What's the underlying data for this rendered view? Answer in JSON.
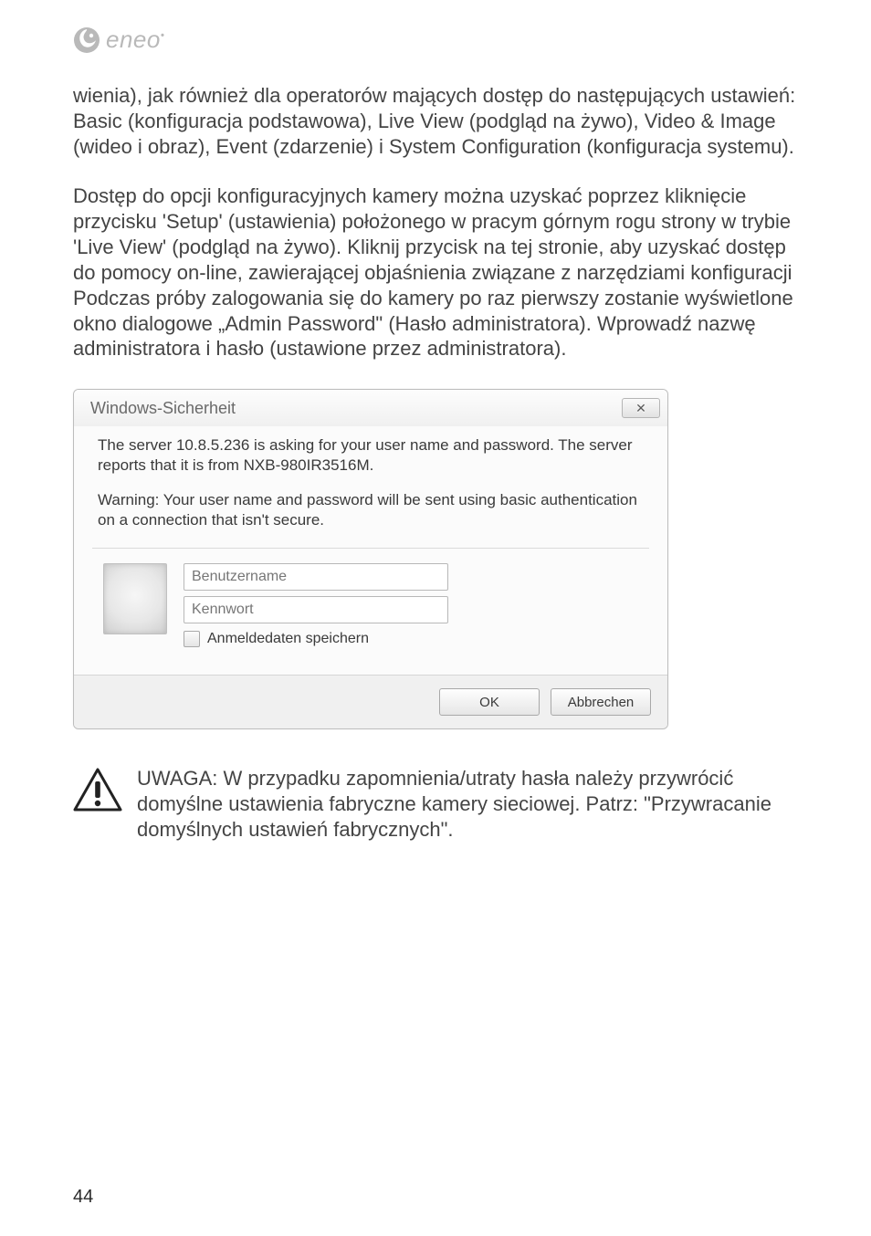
{
  "logo": {
    "text": "eneo"
  },
  "paragraphs": {
    "p1": "wienia), jak również dla operatorów mających dostęp do następujących ustawień: Basic (konfiguracja podstawowa), Live View (podgląd na żywo), Video & Image (wideo i obraz), Event (zdarzenie) i System Configuration (konfiguracja systemu).",
    "p2": "Dostęp do opcji konfiguracyjnych kamery można uzyskać poprzez kliknięcie przycisku 'Setup' (ustawienia) położonego w pracym górnym rogu strony w trybie 'Live View' (podgląd na żywo). Kliknij przycisk na tej stronie, aby uzyskać dostęp do pomocy on-line, zawierającej objaśnienia związane z narzędziami konfiguracji",
    "p3": "Podczas próby zalogowania się do kamery po raz pierwszy zostanie wyświetlone okno dialogowe „Admin Password\" (Hasło administratora). Wprowadź nazwę administratora i hasło (ustawione przez administratora)."
  },
  "dialog": {
    "title": "Windows-Sicherheit",
    "close_glyph": "✕",
    "message": "The server 10.8.5.236 is asking for your user name and password. The server reports that it is from NXB-980IR3516M.",
    "warning": "Warning: Your user name and password will be sent using basic authentication on a connection that isn't secure.",
    "username_placeholder": "Benutzername",
    "password_placeholder": "Kennwort",
    "remember_label": "Anmeldedaten speichern",
    "ok_label": "OK",
    "cancel_label": "Abbrechen"
  },
  "note": {
    "text": "UWAGA: W przypadku zapomnienia/utraty hasła należy przywrócić domyślne ustawienia fabryczne kamery sieciowej. Patrz: \"Przywracanie domyślnych ustawień fabrycznych\"."
  },
  "page_number": "44"
}
